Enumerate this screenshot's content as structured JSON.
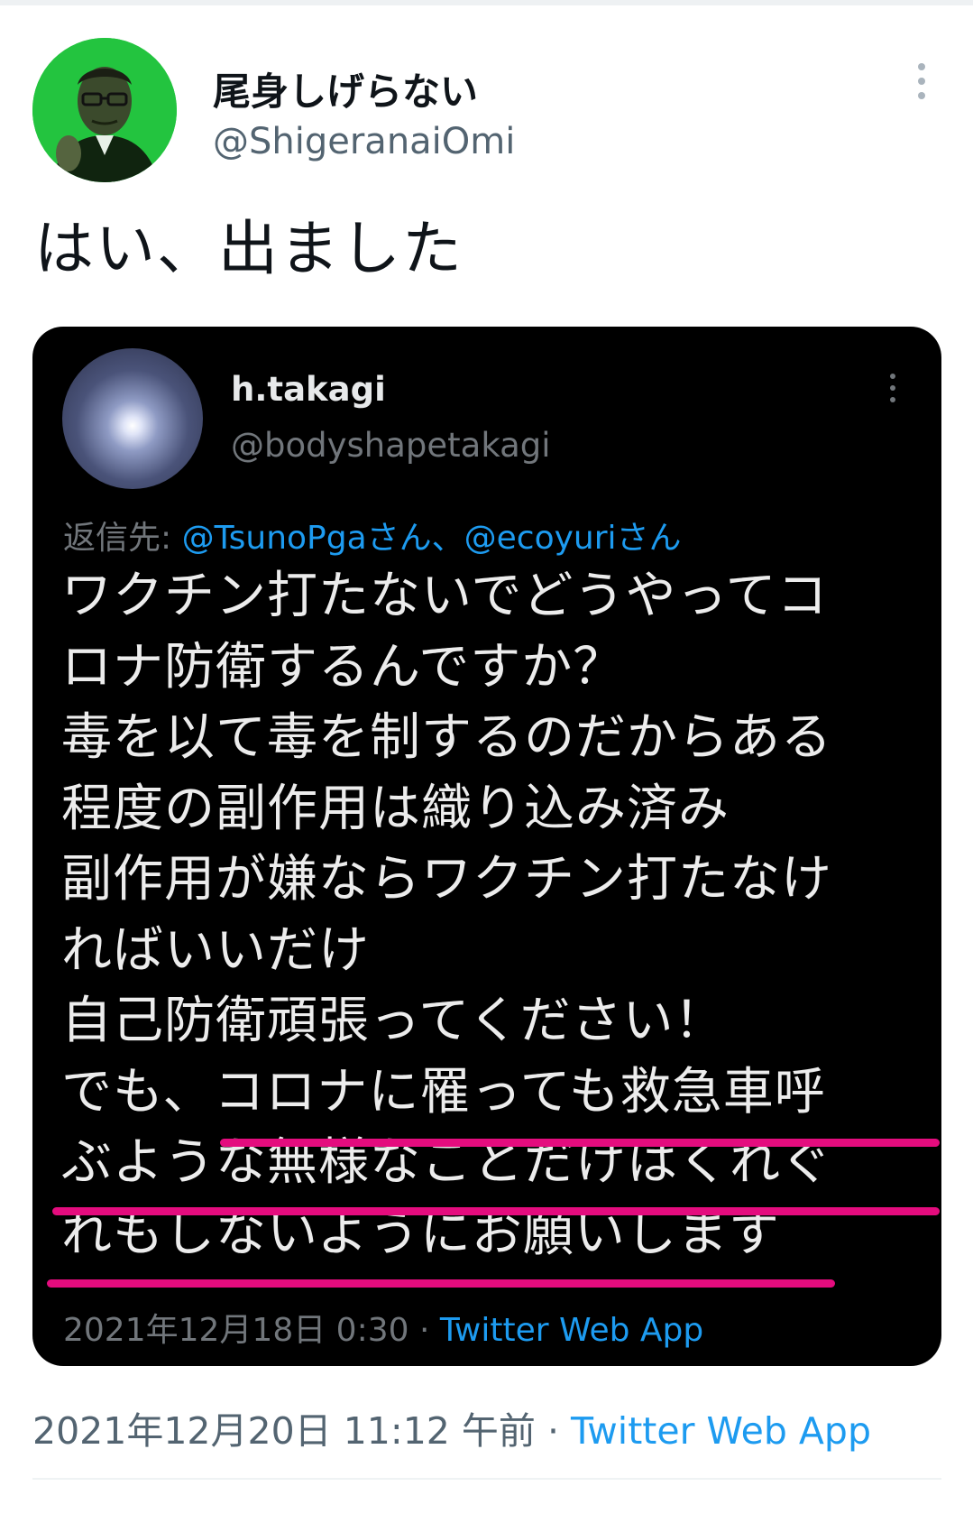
{
  "tweet": {
    "display_name": "尾身しげらない",
    "handle": "@ShigeranaiOmi",
    "text": "はい、出ました",
    "timestamp": "2021年12月20日 11:12 午前",
    "separator": " · ",
    "source": "Twitter Web App"
  },
  "embedded": {
    "display_name": "h.takagi",
    "handle": "@bodyshapetakagi",
    "reply_prefix": "返信先:",
    "reply_to": "@TsunoPgaさん、@ecoyuriさん",
    "lines": [
      "ワクチン打たないでどうやってコ",
      "ロナ防衛するんですか？",
      "毒を以て毒を制するのだからある",
      "程度の副作用は織り込み済み",
      "副作用が嫌ならワクチン打たなけ",
      "ればいいだけ",
      "自己防衛頑張ってください！",
      "でも、コロナに罹っても救急車呼",
      "ぶような無様なことだけはくれぐ",
      "れもしないようにお願いします"
    ],
    "timestamp": "2021年12月18日 0:30",
    "separator": " · ",
    "source": "Twitter Web App"
  },
  "colors": {
    "highlight_underline": "#e40c7e",
    "link": "#1d9bf0",
    "avatar_bg": "#23c43f"
  },
  "icons": {
    "tweet_more": "more-vertical-icon",
    "embedded_more": "more-vertical-icon"
  }
}
